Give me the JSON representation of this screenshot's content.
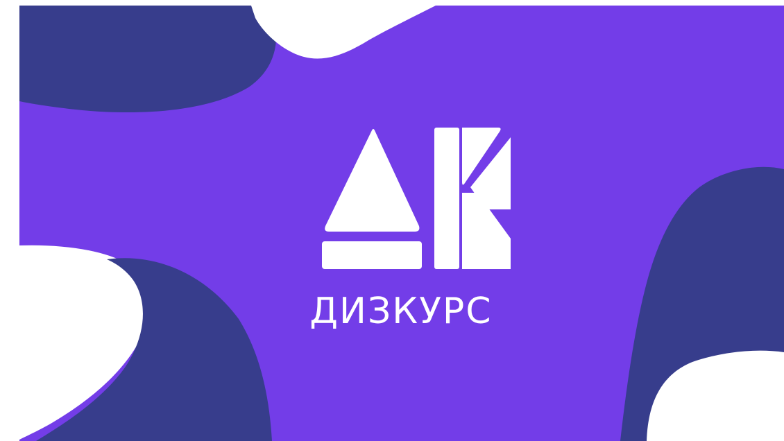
{
  "brand": {
    "name": "ДИЗКУРС"
  },
  "colors": {
    "background": "#733de8",
    "blob_dark": "#373d8c",
    "blob_light": "#ffffff",
    "logo": "#ffffff"
  },
  "icons": {
    "logo": "diskurs-logo-icon"
  }
}
